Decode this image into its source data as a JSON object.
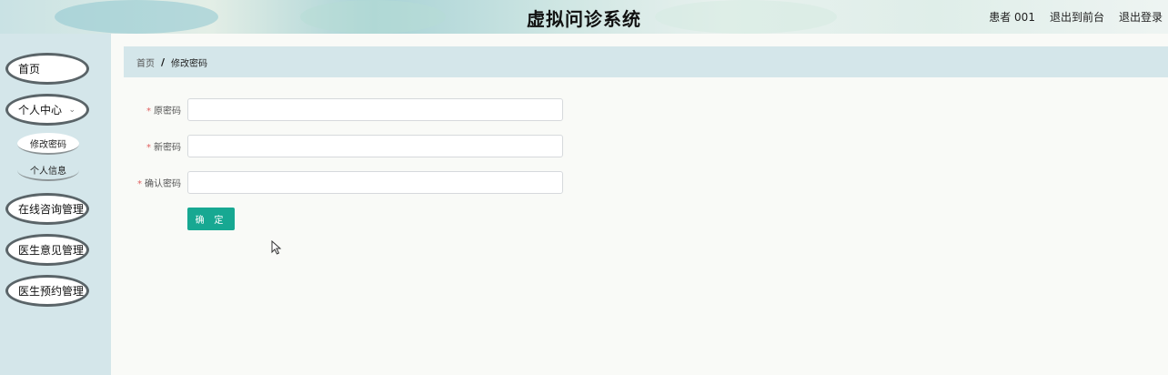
{
  "header": {
    "title": "虚拟问诊系统",
    "user": "患者 001",
    "links": [
      "退出到前台",
      "退出登录"
    ]
  },
  "sidebar": {
    "items": [
      {
        "label": "首页"
      },
      {
        "label": "个人中心",
        "expanded": true,
        "children": [
          {
            "label": "修改密码",
            "active": true
          },
          {
            "label": "个人信息"
          }
        ]
      },
      {
        "label": "在线咨询管理"
      },
      {
        "label": "医生意见管理"
      },
      {
        "label": "医生预约管理"
      }
    ]
  },
  "breadcrumb": {
    "home": "首页",
    "separator": "/",
    "current": "修改密码"
  },
  "form": {
    "fields": [
      {
        "label": "原密码",
        "value": "",
        "required": true
      },
      {
        "label": "新密码",
        "value": "",
        "required": true
      },
      {
        "label": "确认密码",
        "value": "",
        "required": true
      }
    ],
    "required_mark": "*",
    "submit_label": "确 定"
  },
  "colors": {
    "accent": "#17a892",
    "sidebar_bg": "#d4e6ea",
    "required": "#e06060"
  }
}
